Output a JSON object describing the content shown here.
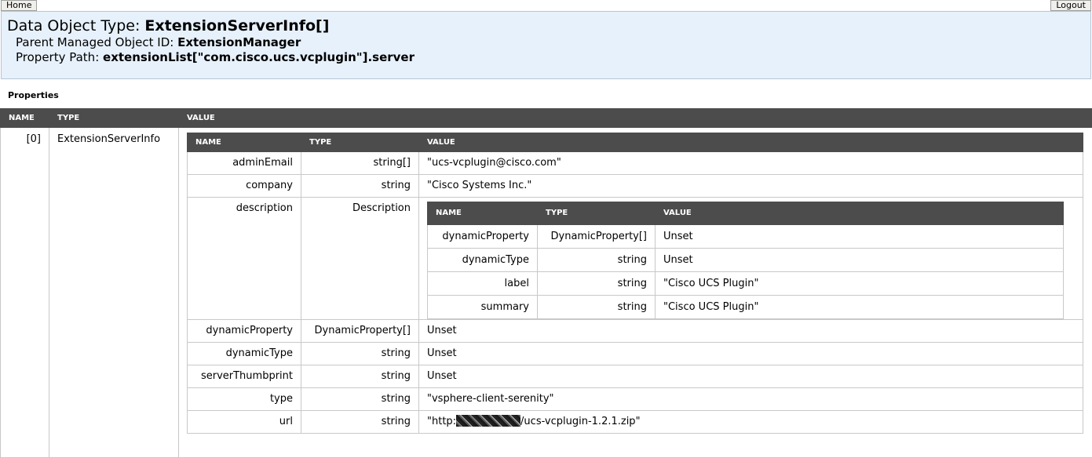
{
  "nav": {
    "home_label": "Home",
    "logout_label": "Logout"
  },
  "header": {
    "type_label": "Data Object Type: ",
    "type_value": "ExtensionServerInfo[]",
    "parent_label": "Parent Managed Object ID: ",
    "parent_value": "ExtensionManager",
    "path_label": "Property Path: ",
    "path_value": "extensionList[\"com.cisco.ucs.vcplugin\"].server"
  },
  "properties_title": "Properties",
  "outer": {
    "headers": [
      "NAME",
      "TYPE",
      "VALUE"
    ],
    "row": {
      "name": "[0]",
      "type": "ExtensionServerInfo"
    }
  },
  "mid": {
    "headers": [
      "NAME",
      "TYPE",
      "VALUE"
    ],
    "rows": [
      {
        "name": "adminEmail",
        "type": "string[]",
        "value": "\"ucs-vcplugin@cisco.com\""
      },
      {
        "name": "company",
        "type": "string",
        "value": "\"Cisco Systems Inc.\""
      },
      {
        "name": "description",
        "type": "Description"
      },
      {
        "name": "dynamicProperty",
        "type": "DynamicProperty[]",
        "value": "Unset"
      },
      {
        "name": "dynamicType",
        "type": "string",
        "value": "Unset"
      },
      {
        "name": "serverThumbprint",
        "type": "string",
        "value": "Unset"
      },
      {
        "name": "type",
        "type": "string",
        "value": "\"vsphere-client-serenity\""
      },
      {
        "name": "url",
        "type": "string",
        "value_prefix": "\"http:",
        "value_suffix": "/ucs-vcplugin-1.2.1.zip\""
      }
    ]
  },
  "inner": {
    "headers": [
      "NAME",
      "TYPE",
      "VALUE"
    ],
    "rows": [
      {
        "name": "dynamicProperty",
        "type": "DynamicProperty[]",
        "value": "Unset"
      },
      {
        "name": "dynamicType",
        "type": "string",
        "value": "Unset"
      },
      {
        "name": "label",
        "type": "string",
        "value": "\"Cisco UCS Plugin\""
      },
      {
        "name": "summary",
        "type": "string",
        "value": "\"Cisco UCS Plugin\""
      }
    ]
  }
}
